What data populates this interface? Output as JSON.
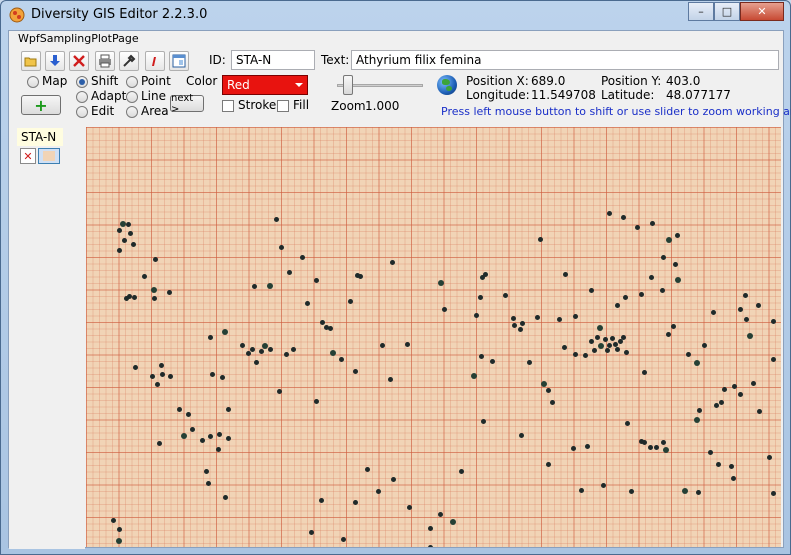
{
  "window": {
    "title": "Diversity GIS Editor 2.2.3.0",
    "minimize": "–",
    "maximize": "□",
    "close": "✕"
  },
  "menu": {
    "items": [
      "WpfSamplingPlotPage"
    ]
  },
  "toolbar": {
    "icons": [
      "open-folder-icon",
      "download-icon",
      "delete-icon",
      "print-icon",
      "settings-tools-icon",
      "edit-pen-icon",
      "window-layout-icon"
    ]
  },
  "fields": {
    "id_label": "ID:",
    "id_value": "STA-N",
    "text_label": "Text:",
    "text_value": "Athyrium filix femina"
  },
  "modes": {
    "map": "Map",
    "shift": "Shift",
    "adapt": "Adapt",
    "edit": "Edit",
    "point": "Point",
    "line": "Line",
    "area": "Area",
    "selected": "Shift",
    "next": "next >",
    "add": "+"
  },
  "style": {
    "color_label": "Color",
    "color_value": "Red",
    "color_hex": "#e8130f",
    "stroke": "Stroke",
    "fill": "Fill",
    "stroke_checked": false,
    "fill_checked": false
  },
  "zoom": {
    "label": "Zoom",
    "value": "1.000"
  },
  "position": {
    "x_label": "Position X:",
    "x_value": "689.0",
    "y_label": "Position Y:",
    "y_value": "403.0",
    "lon_label": "Longitude:",
    "lon_value": "11.549708",
    "lat_label": "Latitude:",
    "lat_value": "48.077177"
  },
  "hint": "Press left mouse button to shift or use slider to zoom working area",
  "sidebar": {
    "plot_label": "STA-N"
  },
  "colors": {
    "accent": "#1a2fc8",
    "paper": "#f1d4b6",
    "grid": "#ce5c3e"
  }
}
